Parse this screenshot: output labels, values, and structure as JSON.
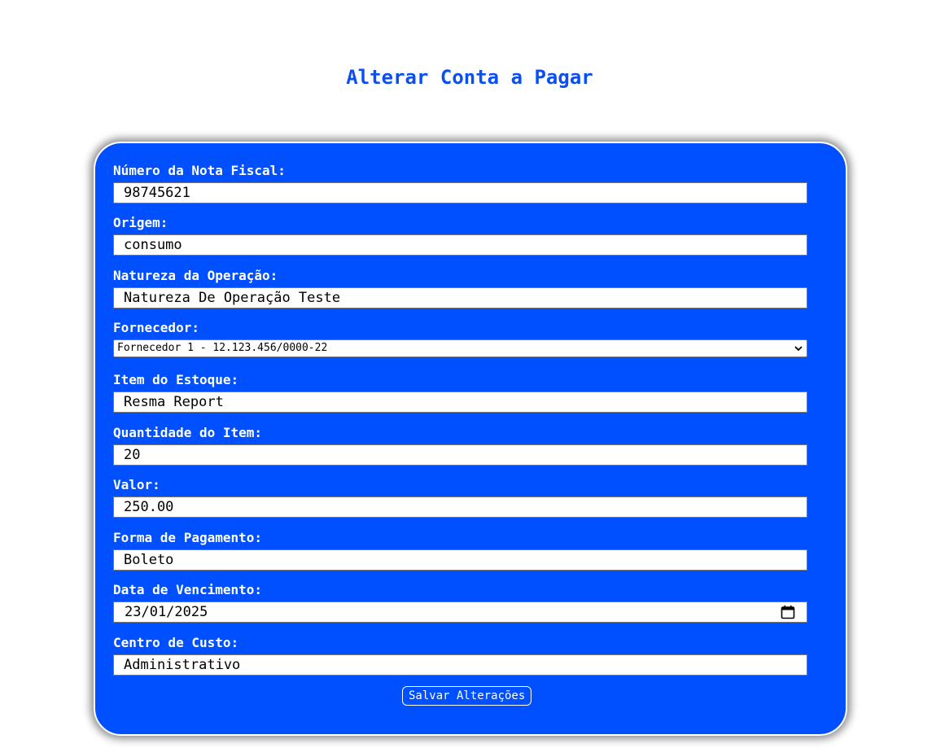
{
  "page": {
    "title": "Alterar Conta a Pagar"
  },
  "form": {
    "nota_fiscal": {
      "label": "Número da Nota Fiscal:",
      "value": "98745621"
    },
    "origem": {
      "label": "Origem:",
      "value": "consumo"
    },
    "natureza": {
      "label": "Natureza da Operação:",
      "value": "Natureza De Operação Teste"
    },
    "fornecedor": {
      "label": "Fornecedor:",
      "selected": "Fornecedor 1 - 12.123.456/0000-22"
    },
    "item_estoque": {
      "label": "Item do Estoque:",
      "value": "Resma Report"
    },
    "quantidade": {
      "label": "Quantidade do Item:",
      "value": "20"
    },
    "valor": {
      "label": "Valor:",
      "value": "250.00"
    },
    "forma_pagamento": {
      "label": "Forma de Pagamento:",
      "value": "Boleto"
    },
    "vencimento": {
      "label": "Data de Vencimento:",
      "value": "23/01/2025"
    },
    "centro_custo": {
      "label": "Centro de Custo:",
      "value": "Administrativo"
    },
    "save_label": "Salvar Alterações"
  },
  "colors": {
    "title": "#0a50f0",
    "card_background": "#0050ff",
    "label_text": "#ffffff"
  },
  "icons": {
    "select_arrow": "chevron-down-icon",
    "date_picker": "calendar-icon"
  }
}
